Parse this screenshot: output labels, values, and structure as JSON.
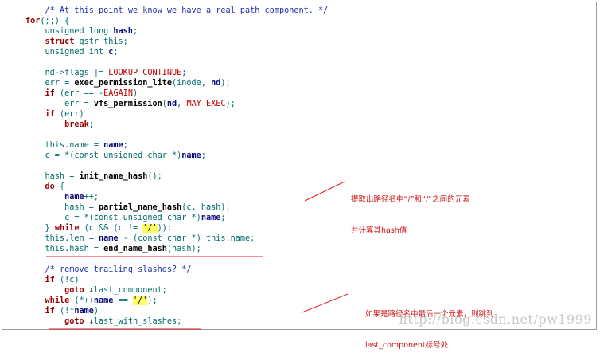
{
  "code_lines": [
    [
      {
        "t": "    ",
        "c": "pl"
      },
      {
        "t": "/* At this point we know we have a real path component. */",
        "c": "cm"
      }
    ],
    [
      {
        "t": "for",
        "c": "kw"
      },
      {
        "t": "(;;) {",
        "c": "pl"
      }
    ],
    [
      {
        "t": "    unsigned long ",
        "c": "pl"
      },
      {
        "t": "hash",
        "c": "id"
      },
      {
        "t": ";",
        "c": "pl"
      }
    ],
    [
      {
        "t": "    ",
        "c": "pl"
      },
      {
        "t": "struct",
        "c": "kw"
      },
      {
        "t": " qstr this;",
        "c": "pl"
      }
    ],
    [
      {
        "t": "    unsigned int ",
        "c": "pl"
      },
      {
        "t": "c",
        "c": "id"
      },
      {
        "t": ";",
        "c": "pl"
      }
    ],
    [
      {
        "t": "",
        "c": "pl"
      }
    ],
    [
      {
        "t": "    nd->flags |= ",
        "c": "pl"
      },
      {
        "t": "LOOKUP_CONTINUE",
        "c": "mc"
      },
      {
        "t": ";",
        "c": "pl"
      }
    ],
    [
      {
        "t": "    err = ",
        "c": "pl"
      },
      {
        "t": "exec_permission_lite",
        "c": "fn"
      },
      {
        "t": "(inode, ",
        "c": "pl"
      },
      {
        "t": "nd",
        "c": "id"
      },
      {
        "t": ");",
        "c": "pl"
      }
    ],
    [
      {
        "t": "    ",
        "c": "pl"
      },
      {
        "t": "if",
        "c": "kw"
      },
      {
        "t": " (err == -",
        "c": "pl"
      },
      {
        "t": "EAGAIN",
        "c": "mc"
      },
      {
        "t": ")",
        "c": "pl"
      }
    ],
    [
      {
        "t": "        err = ",
        "c": "pl"
      },
      {
        "t": "vfs_permission",
        "c": "fn"
      },
      {
        "t": "(",
        "c": "pl"
      },
      {
        "t": "nd",
        "c": "id"
      },
      {
        "t": ", ",
        "c": "pl"
      },
      {
        "t": "MAY_EXEC",
        "c": "mc"
      },
      {
        "t": ");",
        "c": "pl"
      }
    ],
    [
      {
        "t": "    ",
        "c": "pl"
      },
      {
        "t": "if",
        "c": "kw"
      },
      {
        "t": " (err)",
        "c": "pl"
      }
    ],
    [
      {
        "t": "        ",
        "c": "pl"
      },
      {
        "t": "break",
        "c": "kw"
      },
      {
        "t": ";",
        "c": "pl"
      }
    ],
    [
      {
        "t": "",
        "c": "pl"
      }
    ],
    [
      {
        "t": "    this.name = ",
        "c": "pl"
      },
      {
        "t": "name",
        "c": "id"
      },
      {
        "t": ";",
        "c": "pl"
      }
    ],
    [
      {
        "t": "    c = *(const unsigned char *)",
        "c": "pl"
      },
      {
        "t": "name",
        "c": "id"
      },
      {
        "t": ";",
        "c": "pl"
      }
    ],
    [
      {
        "t": "",
        "c": "pl"
      }
    ],
    [
      {
        "t": "    hash = ",
        "c": "pl"
      },
      {
        "t": "init_name_hash",
        "c": "fn"
      },
      {
        "t": "();",
        "c": "pl"
      }
    ],
    [
      {
        "t": "    ",
        "c": "pl"
      },
      {
        "t": "do",
        "c": "kw"
      },
      {
        "t": " {",
        "c": "pl"
      }
    ],
    [
      {
        "t": "        ",
        "c": "pl"
      },
      {
        "t": "name",
        "c": "id"
      },
      {
        "t": "++;",
        "c": "pl"
      }
    ],
    [
      {
        "t": "        hash = ",
        "c": "pl"
      },
      {
        "t": "partial_name_hash",
        "c": "fn"
      },
      {
        "t": "(c, hash);",
        "c": "pl"
      }
    ],
    [
      {
        "t": "        c = *(const unsigned char *)",
        "c": "pl"
      },
      {
        "t": "name",
        "c": "id"
      },
      {
        "t": ";",
        "c": "pl"
      }
    ],
    [
      {
        "t": "    } ",
        "c": "pl"
      },
      {
        "t": "while",
        "c": "kw"
      },
      {
        "t": " (c && (c != ",
        "c": "pl"
      },
      {
        "t": "'/'",
        "c": "st"
      },
      {
        "t": "));",
        "c": "pl"
      }
    ],
    [
      {
        "t": "    this.len = ",
        "c": "pl"
      },
      {
        "t": "name",
        "c": "id"
      },
      {
        "t": " - (const char *) this.name;",
        "c": "pl"
      }
    ],
    [
      {
        "t": "    this.hash = ",
        "c": "pl"
      },
      {
        "t": "end_name_hash",
        "c": "fn"
      },
      {
        "t": "(hash);",
        "c": "pl"
      }
    ],
    [
      {
        "t": "",
        "c": "pl"
      }
    ],
    [
      {
        "t": "    ",
        "c": "pl"
      },
      {
        "t": "/* remove trailing slashes? */",
        "c": "cm"
      }
    ],
    [
      {
        "t": "    ",
        "c": "pl"
      },
      {
        "t": "if",
        "c": "kw"
      },
      {
        "t": " (!c)",
        "c": "pl"
      }
    ],
    [
      {
        "t": "        ",
        "c": "pl"
      },
      {
        "t": "goto",
        "c": "kw"
      },
      {
        "t": " ",
        "c": "pl"
      },
      {
        "t": "↓",
        "c": "arrow"
      },
      {
        "t": "last_component;",
        "c": "pl"
      }
    ],
    [
      {
        "t": "    ",
        "c": "pl"
      },
      {
        "t": "while",
        "c": "kw"
      },
      {
        "t": " (*++",
        "c": "pl"
      },
      {
        "t": "name",
        "c": "id"
      },
      {
        "t": " == ",
        "c": "pl"
      },
      {
        "t": "'/'",
        "c": "st"
      },
      {
        "t": ");",
        "c": "pl"
      }
    ],
    [
      {
        "t": "    ",
        "c": "pl"
      },
      {
        "t": "if",
        "c": "kw"
      },
      {
        "t": " (!*",
        "c": "pl"
      },
      {
        "t": "name",
        "c": "id"
      },
      {
        "t": ")",
        "c": "pl"
      }
    ],
    [
      {
        "t": "        ",
        "c": "pl"
      },
      {
        "t": "goto",
        "c": "kw"
      },
      {
        "t": " ",
        "c": "pl"
      },
      {
        "t": "↓",
        "c": "arrow"
      },
      {
        "t": "last_with_slashes;",
        "c": "pl"
      }
    ]
  ],
  "annotations": {
    "note1_line1": "提取出路径名中“/”和“/”之间的元素",
    "note1_line2": "并计算其hash值",
    "note2_line1": "如果是路径名中最后一个元素，则跳到",
    "note2_line2": "last_component标号处"
  },
  "watermark": "http://blog.csdn.net/pw1999",
  "colors": {
    "comment": "#1f2fb0",
    "keyword": "#9b0000",
    "macro": "#c00000",
    "plain": "#006b6b",
    "string_bg": "#ffff66",
    "annotation": "#d01010"
  }
}
